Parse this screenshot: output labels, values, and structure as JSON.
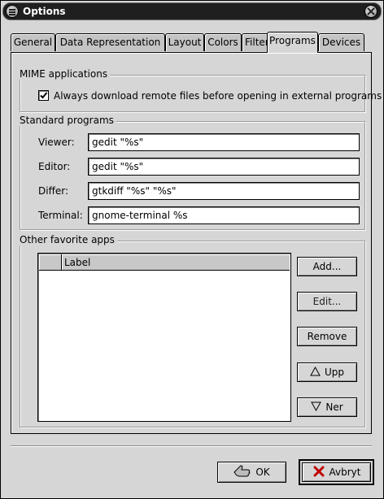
{
  "window": {
    "title": "Options"
  },
  "tabs": [
    {
      "label": "General"
    },
    {
      "label": "Data Representation"
    },
    {
      "label": "Layout"
    },
    {
      "label": "Colors"
    },
    {
      "label": "Filters"
    },
    {
      "label": "Programs",
      "active": true
    },
    {
      "label": "Devices"
    }
  ],
  "mime": {
    "frame_title": "MIME applications",
    "download_checkbox_label": "Always download remote files before opening in external programs",
    "download_checked": true
  },
  "standard_programs": {
    "frame_title": "Standard programs",
    "viewer": {
      "label": "Viewer:",
      "value": "gedit \"%s\""
    },
    "editor": {
      "label": "Editor:",
      "value": "gedit \"%s\""
    },
    "differ": {
      "label": "Differ:",
      "value": "gtkdiff \"%s\" \"%s\""
    },
    "terminal": {
      "label": "Terminal:",
      "value": "gnome-terminal %s"
    }
  },
  "favorites": {
    "frame_title": "Other favorite apps",
    "column_label": "Label",
    "rows": [],
    "add_label": "Add...",
    "edit_label": "Edit...",
    "remove_label": "Remove",
    "up_label": "Upp",
    "down_label": "Ner"
  },
  "footer": {
    "ok_label": "OK",
    "cancel_label": "Avbryt"
  },
  "icons": {
    "window_menu": "window-menu-icon",
    "close": "close-icon",
    "up": "up-triangle-icon",
    "down": "down-triangle-icon",
    "ok": "thumbs-up-icon",
    "cancel": "cross-icon"
  },
  "colors": {
    "titlebar": "#1f1f1f",
    "background": "#d6d6d6",
    "cancel_icon": "#c00000"
  }
}
